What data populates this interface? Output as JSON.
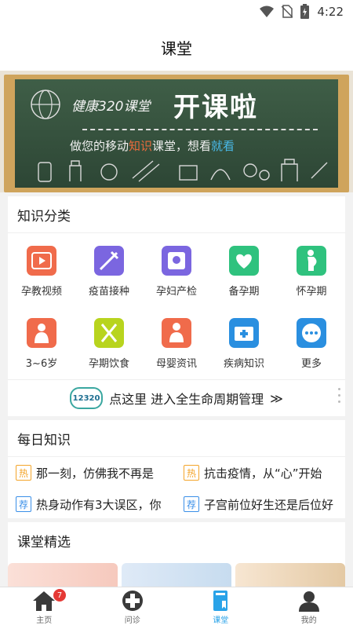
{
  "status_bar": {
    "time": "4:22",
    "icons": [
      "wifi-icon",
      "no-sim-icon",
      "battery-charging-icon"
    ]
  },
  "header": {
    "title": "课堂"
  },
  "banner": {
    "title_left": "健康320课堂",
    "title_right": "开课啦",
    "subtitle_pre": "做您的移动",
    "subtitle_k1": "知识",
    "subtitle_mid": "课堂，想看",
    "subtitle_k2": "就看"
  },
  "categories": {
    "title": "知识分类",
    "items": [
      {
        "label": "孕教视频",
        "icon": "video-play-icon",
        "color": "#f06b4b"
      },
      {
        "label": "疫苗接种",
        "icon": "syringe-icon",
        "color": "#7b66e0"
      },
      {
        "label": "孕妇产检",
        "icon": "pregnant-check-icon",
        "color": "#7b66e0"
      },
      {
        "label": "备孕期",
        "icon": "heart-hands-icon",
        "color": "#2fc27e"
      },
      {
        "label": "怀孕期",
        "icon": "pregnant-woman-icon",
        "color": "#2fc27e"
      },
      {
        "label": "3~6岁",
        "icon": "child-icon",
        "color": "#f06b4b"
      },
      {
        "label": "孕期饮食",
        "icon": "fork-spoon-icon",
        "color": "#b8d41e"
      },
      {
        "label": "母婴资讯",
        "icon": "mother-baby-icon",
        "color": "#f06b4b"
      },
      {
        "label": "疾病知识",
        "icon": "medical-kit-icon",
        "color": "#2a8fe0"
      },
      {
        "label": "更多",
        "icon": "more-dots-icon",
        "color": "#2a8fe0"
      }
    ]
  },
  "lifecycle": {
    "logo": "12320",
    "text": "点这里 进入全生命周期管理",
    "arrow": "≫"
  },
  "daily": {
    "title": "每日知识",
    "items": [
      {
        "tag": "热",
        "type": "hot",
        "text": "那一刻，仿佛我不再是"
      },
      {
        "tag": "热",
        "type": "hot",
        "text": "抗击疫情，从“心”开始"
      },
      {
        "tag": "荐",
        "type": "rec",
        "text": "热身动作有3大误区，你"
      },
      {
        "tag": "荐",
        "type": "rec",
        "text": "子宫前位好生还是后位好"
      }
    ]
  },
  "picks": {
    "title": "课堂精选"
  },
  "tabs": [
    {
      "label": "主页",
      "icon": "home-icon",
      "badge": "7"
    },
    {
      "label": "问诊",
      "icon": "medical-cross-icon"
    },
    {
      "label": "课堂",
      "icon": "book-icon",
      "active": true
    },
    {
      "label": "我的",
      "icon": "person-icon"
    }
  ],
  "colors": {
    "accent": "#2aa3e8",
    "hot": "#f4a52a",
    "rec": "#3a8fe8",
    "badge": "#e53935"
  }
}
